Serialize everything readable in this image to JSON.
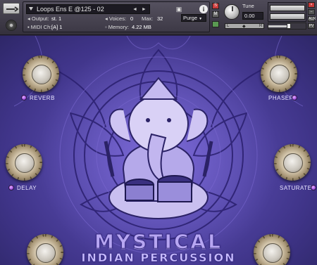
{
  "header": {
    "instrument_name": "Loops Ens E @125 - 02",
    "nav_arrows": "◄ ►",
    "output_label": "Output:",
    "output_value": "st. 1",
    "midi_label": "MIDI Ch:",
    "midi_value": "[A] 1",
    "voices_label": "Voices:",
    "voices_value": "0",
    "max_label": "Max:",
    "max_value": "32",
    "memory_label": "Memory:",
    "memory_value": "4.22 MB",
    "purge_label": "Purge",
    "info_glyph": "i",
    "tune_label": "Tune",
    "tune_value": "0.00",
    "s_btn": "S",
    "m_btn": "M",
    "l_btn": "L",
    "r_btn": "R",
    "aux_btn": "AUX",
    "pv_btn": "PV"
  },
  "effects": {
    "reverb": "REVERB",
    "phaser": "PHASER",
    "delay": "DELAY",
    "saturate": "SATURATE"
  },
  "title": {
    "line1": "MYSTICAL",
    "line2": "INDIAN PERCUSSION"
  },
  "levels": {
    "volume": 0.55
  },
  "colors": {
    "panel_purple": "#5447a8",
    "led_purple": "#a24fe0",
    "title_lilac": "#b7a6f2"
  }
}
